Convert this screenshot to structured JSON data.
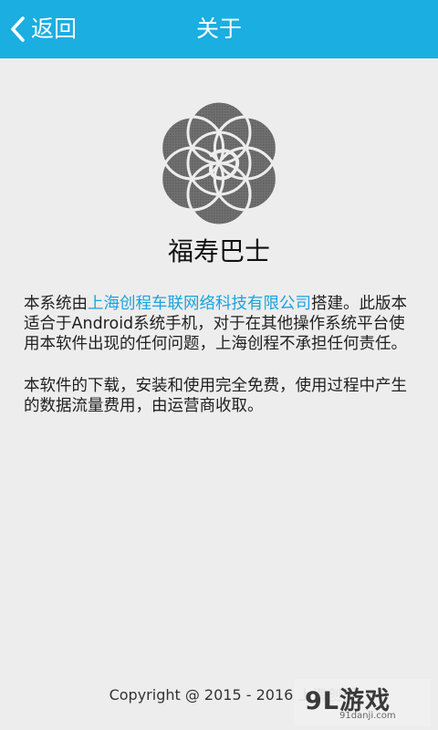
{
  "header": {
    "back_label": "返回",
    "title": "关于"
  },
  "app": {
    "name": "福寿巴士"
  },
  "description": {
    "p1_before_link": "本系统由",
    "p1_link": "上海创程车联网络科技有限公司",
    "p1_after_link": "搭建。此版本适合于Android系统手机，对于在其他操作系统平台使用本软件出现的任何问题，上海创程不承担任何责任。",
    "p2": "本软件的下载，安装和使用完全免费，使用过程中产生的数据流量费用，由运营商收取。"
  },
  "footer": {
    "copyright": "Copyright @ 2015 - 2016 上海创程"
  },
  "watermark": {
    "main": "9L游戏",
    "sub": "91danji.com"
  },
  "colors": {
    "header_bg": "#1aaee1",
    "link": "#1aa3dd",
    "page_bg": "#ededed",
    "logo": "#6d6d6d"
  },
  "icons": {
    "back": "chevron-left-icon",
    "logo": "flower-of-life-logo"
  }
}
